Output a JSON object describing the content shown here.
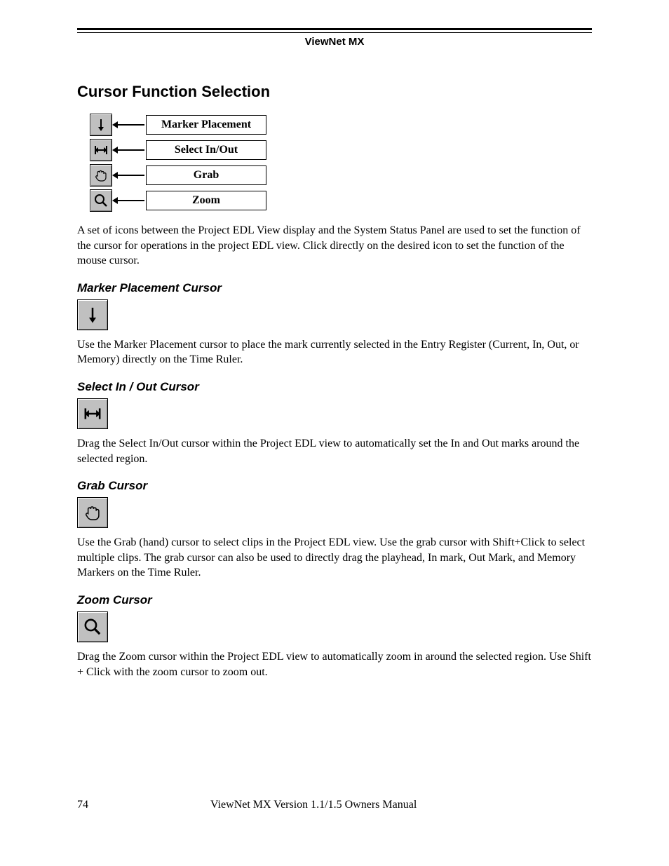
{
  "header": {
    "product": "ViewNet MX"
  },
  "section": {
    "title": "Cursor Function Selection"
  },
  "diagram": {
    "rows": [
      {
        "icon": "marker-down-icon",
        "label": "Marker Placement"
      },
      {
        "icon": "select-inout-icon",
        "label": "Select In/Out"
      },
      {
        "icon": "grab-hand-icon",
        "label": "Grab"
      },
      {
        "icon": "zoom-magnifier-icon",
        "label": "Zoom"
      }
    ]
  },
  "intro": "A set of icons between the Project EDL View display and the System Status Panel are used to set the function of the cursor for operations in the project EDL view. Click directly on the desired icon to set the function of the mouse cursor.",
  "subsections": {
    "marker": {
      "title": "Marker Placement Cursor",
      "body": "Use the Marker Placement cursor to place the mark currently selected in the Entry Register (Current, In, Out, or Memory) directly on the Time Ruler."
    },
    "select": {
      "title": "Select In / Out Cursor",
      "body": "Drag the Select In/Out cursor within the Project EDL view to automatically set the In and Out marks around the selected region."
    },
    "grab": {
      "title": "Grab Cursor",
      "body": "Use the Grab (hand) cursor to select clips in the Project EDL view. Use the grab cursor with Shift+Click to select multiple clips. The grab cursor can also be used to directly drag the playhead, In mark, Out Mark, and Memory Markers on the Time Ruler."
    },
    "zoom": {
      "title": "Zoom Cursor",
      "body": "Drag the Zoom cursor within the Project EDL view to automatically zoom in around the selected region. Use Shift + Click with the zoom cursor to zoom out."
    }
  },
  "footer": {
    "page": "74",
    "title": "ViewNet MX Version 1.1/1.5 Owners Manual"
  }
}
